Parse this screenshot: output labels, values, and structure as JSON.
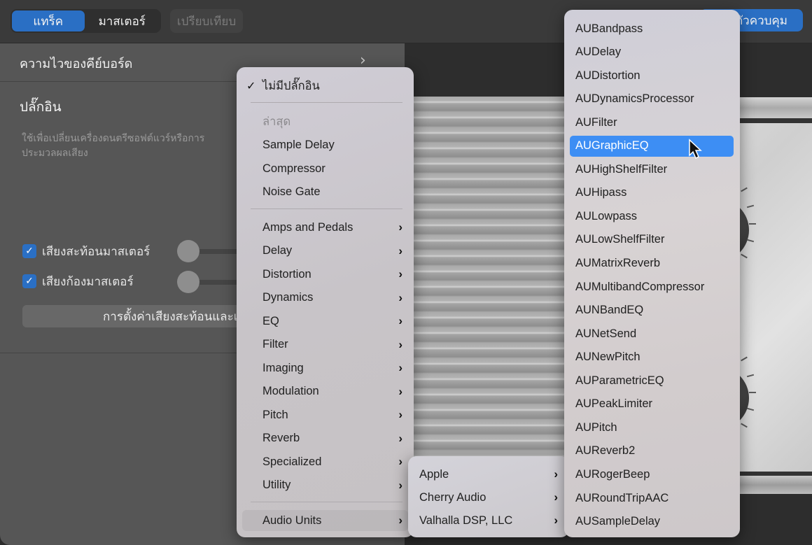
{
  "topbar": {
    "segments": [
      {
        "label": "แทร็ค",
        "active": true
      },
      {
        "label": "มาสเตอร์",
        "active": false
      }
    ],
    "compare_label": "เปรียบเทียบ",
    "controls_label": "ตัวควบคุม",
    "accent_color": "#2a6fc4"
  },
  "left_panel": {
    "keyboard_sensitivity_label": "ความไวของคีย์บอร์ด",
    "plugins_title": "ปลั๊กอิน",
    "plugins_description": "ใช้เพื่อเปลี่ยนเครื่องดนตรีซอฟต์แวร์หรือการประมวลผลเสียง",
    "master_echo": {
      "label": "เสียงสะท้อนมาสเตอร์",
      "checked": true,
      "slider_value": 0
    },
    "master_reverb": {
      "label": "เสียงก้องมาสเตอร์",
      "checked": true,
      "slider_value": 0
    },
    "settings_button_label": "การตั้งค่าเสียงสะท้อนและเสียงก้อง"
  },
  "plugin_menu": {
    "no_plugin": {
      "label": "ไม่มีปลั๊กอิน",
      "checked": true
    },
    "recent_header": "ล่าสุด",
    "recent": [
      "Sample Delay",
      "Compressor",
      "Noise Gate"
    ],
    "categories": [
      "Amps and Pedals",
      "Delay",
      "Distortion",
      "Dynamics",
      "EQ",
      "Filter",
      "Imaging",
      "Modulation",
      "Pitch",
      "Reverb",
      "Specialized",
      "Utility"
    ],
    "audio_units_label": "Audio Units"
  },
  "vendor_menu": {
    "items": [
      "Apple",
      "Cherry Audio",
      "Valhalla DSP, LLC"
    ]
  },
  "au_menu": {
    "items": [
      "AUBandpass",
      "AUDelay",
      "AUDistortion",
      "AUDynamicsProcessor",
      "AUFilter",
      "AUGraphicEQ",
      "AUHighShelfFilter",
      "AUHipass",
      "AULowpass",
      "AULowShelfFilter",
      "AUMatrixReverb",
      "AUMultibandCompressor",
      "AUNBandEQ",
      "AUNetSend",
      "AUNewPitch",
      "AUParametricEQ",
      "AUPeakLimiter",
      "AUPitch",
      "AUReverb2",
      "AURogerBeep",
      "AURoundTripAAC",
      "AUSampleDelay"
    ],
    "selected": "AUGraphicEQ",
    "selected_color": "#3d8ef4"
  }
}
